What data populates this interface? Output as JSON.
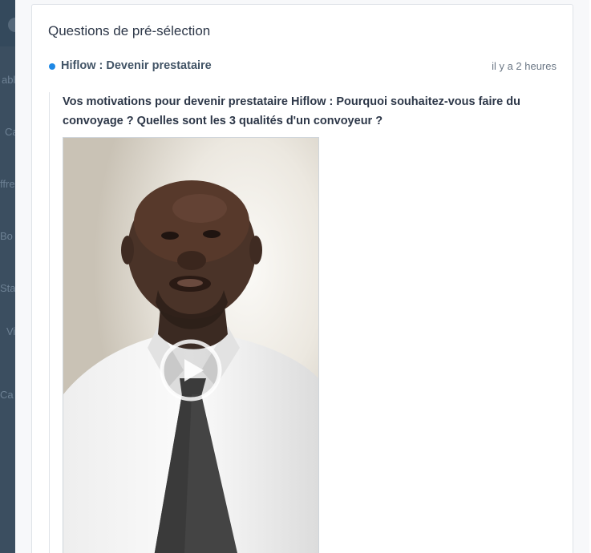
{
  "sidebar": {
    "items": [
      {
        "label": "able"
      },
      {
        "label": "Ca"
      },
      {
        "label": "ffre"
      },
      {
        "label": "Bo"
      },
      {
        "label": "Sta"
      },
      {
        "label": "Vi"
      },
      {
        "label": "Ca"
      }
    ]
  },
  "card": {
    "title": "Questions de pré-sélection"
  },
  "question": {
    "name": "Hiflow : Devenir prestataire",
    "time": "il y a 2 heures",
    "text": "Vos motivations pour devenir prestataire Hiflow : Pourquoi souhaitez-vous faire du convoyage ? Quelles sont les 3 qualités d'un convoyeur ?"
  },
  "video": {
    "play_icon": "play-icon"
  },
  "colors": {
    "accent": "#1e88e5",
    "sidebar": "#3b4e60"
  }
}
